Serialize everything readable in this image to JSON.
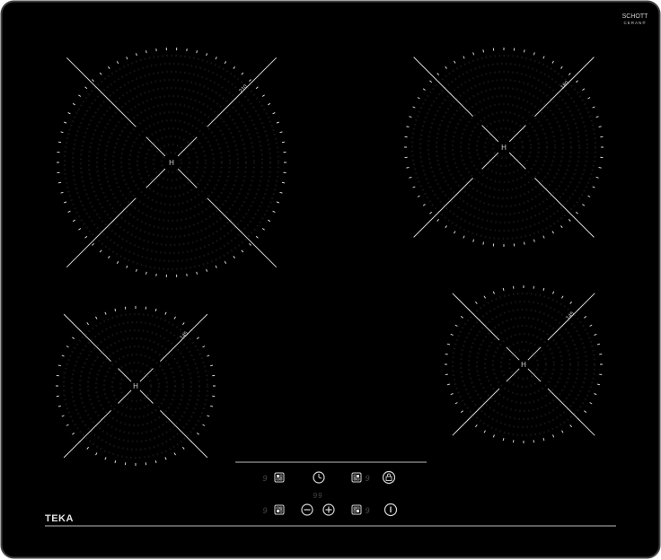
{
  "brand": {
    "logo_text": "TEKA",
    "glass_maker_line1": "SCHOTT",
    "glass_maker_line2": "CERAN",
    "glass_maker_mark": "®"
  },
  "zones": [
    {
      "id": "rear-left",
      "size_label": "210",
      "hot_label": "H"
    },
    {
      "id": "rear-right",
      "size_label": "180",
      "hot_label": "H"
    },
    {
      "id": "front-left",
      "size_label": "145",
      "hot_label": "H"
    },
    {
      "id": "front-right",
      "size_label": "145",
      "hot_label": "H"
    }
  ],
  "controls": {
    "timer_display": "99",
    "digit": "9",
    "top_row": [
      "zone-select",
      "timer",
      "zone-select",
      "lock"
    ],
    "bottom_row": [
      "zone-select",
      "minus",
      "plus",
      "zone-select",
      "power"
    ]
  },
  "colors": {
    "glass": "#000000",
    "outline": "#3a3a3a",
    "print": "#d8d8d8",
    "zone_pattern": "#161616",
    "dim_digit": "#4a4a4a"
  }
}
